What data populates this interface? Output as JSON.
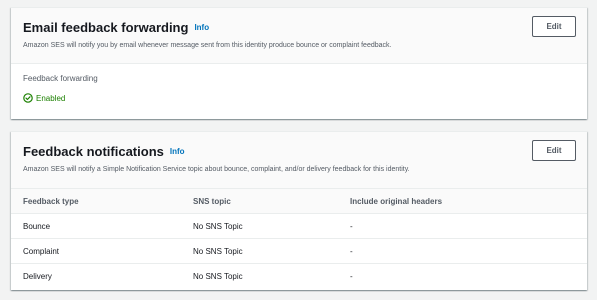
{
  "forwarding": {
    "title": "Email feedback forwarding",
    "info_label": "Info",
    "description": "Amazon SES will notify you by email whenever message sent from this identity produce bounce or complaint feedback.",
    "edit_label": "Edit",
    "field_label": "Feedback forwarding",
    "status": "Enabled"
  },
  "notifications": {
    "title": "Feedback notifications",
    "info_label": "Info",
    "description": "Amazon SES will notify a Simple Notification Service topic about bounce, complaint, and/or delivery feedback for this identity.",
    "edit_label": "Edit",
    "columns": [
      "Feedback type",
      "SNS topic",
      "Include original headers"
    ],
    "rows": [
      {
        "type": "Bounce",
        "topic": "No SNS Topic",
        "headers": "-"
      },
      {
        "type": "Complaint",
        "topic": "No SNS Topic",
        "headers": "-"
      },
      {
        "type": "Delivery",
        "topic": "No SNS Topic",
        "headers": "-"
      }
    ]
  },
  "colors": {
    "success": "#1d8102",
    "link": "#0073bb"
  }
}
